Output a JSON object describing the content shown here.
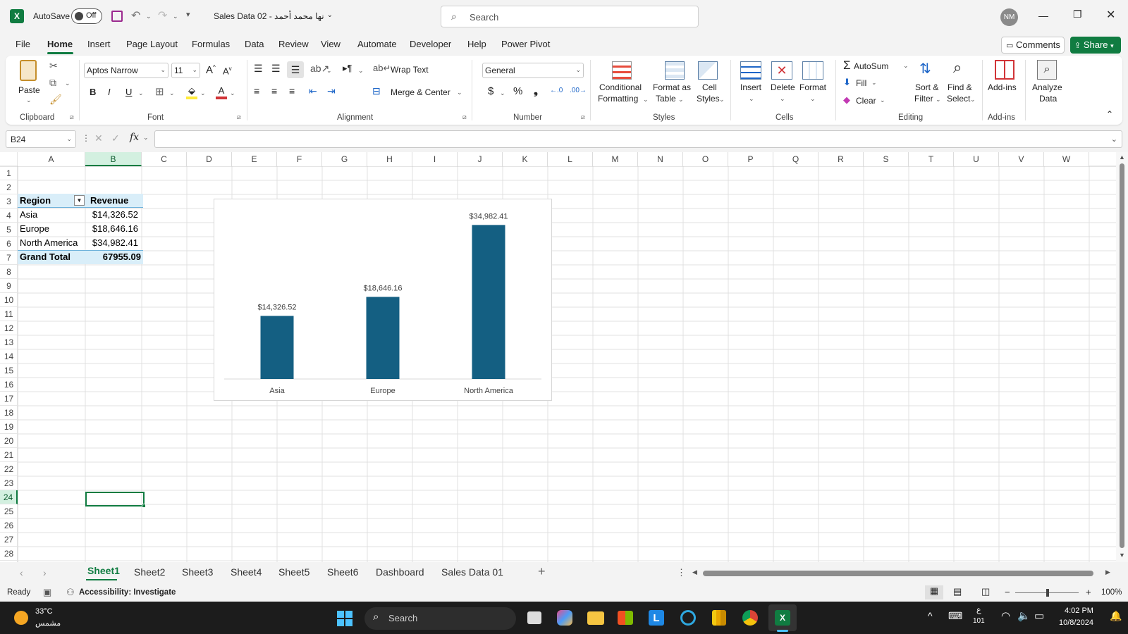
{
  "titlebar": {
    "autosave_label": "AutoSave",
    "autosave_state": "Off",
    "doc_title": "Sales Data 02 - نها محمد أحمد",
    "search_placeholder": "Search",
    "user_initials": "NM"
  },
  "menu": {
    "items": [
      "File",
      "Home",
      "Insert",
      "Page Layout",
      "Formulas",
      "Data",
      "Review",
      "View",
      "Automate",
      "Developer",
      "Help",
      "Power Pivot"
    ],
    "active": "Home",
    "comments_label": "Comments",
    "share_label": "Share"
  },
  "ribbon": {
    "paste": "Paste",
    "font_name": "Aptos Narrow",
    "font_size": "11",
    "wrap_text": "Wrap Text",
    "merge_center": "Merge & Center",
    "number_format": "General",
    "conditional_1": "Conditional",
    "conditional_2": "Formatting",
    "format_table_1": "Format as",
    "format_table_2": "Table",
    "cell_styles_1": "Cell",
    "cell_styles_2": "Styles",
    "insert": "Insert",
    "delete": "Delete",
    "format": "Format",
    "autosum": "AutoSum",
    "fill": "Fill",
    "clear": "Clear",
    "sort_1": "Sort &",
    "sort_2": "Filter",
    "find_1": "Find &",
    "find_2": "Select",
    "addins": "Add-ins",
    "analyze_1": "Analyze",
    "analyze_2": "Data",
    "groups": {
      "clipboard": "Clipboard",
      "font": "Font",
      "alignment": "Alignment",
      "number": "Number",
      "styles": "Styles",
      "cells": "Cells",
      "editing": "Editing",
      "addins": "Add-ins"
    }
  },
  "formula_bar": {
    "name_box": "B24",
    "fx": "fx",
    "content": ""
  },
  "grid": {
    "columns": [
      "A",
      "B",
      "C",
      "D",
      "E",
      "F",
      "G",
      "H",
      "I",
      "J",
      "K",
      "L",
      "M",
      "N",
      "O",
      "P",
      "Q",
      "R",
      "S",
      "T",
      "U",
      "V",
      "W"
    ],
    "rows": [
      "1",
      "2",
      "3",
      "4",
      "5",
      "6",
      "7",
      "8",
      "9",
      "10",
      "11",
      "12",
      "13",
      "14",
      "15",
      "16",
      "17",
      "18",
      "19",
      "20",
      "21",
      "22",
      "23",
      "24",
      "25",
      "26",
      "27",
      "28"
    ],
    "pivot": {
      "header_region": "Region",
      "header_revenue": "Revenue",
      "rows": [
        {
          "region": "Asia",
          "revenue": "$14,326.52"
        },
        {
          "region": "Europe",
          "revenue": "$18,646.16"
        },
        {
          "region": "North America",
          "revenue": "$34,982.41"
        }
      ],
      "total_label": "Grand Total",
      "total_value": "67955.09"
    }
  },
  "chart_data": {
    "type": "bar",
    "categories": [
      "Asia",
      "Europe",
      "North America"
    ],
    "values": [
      14326.52,
      18646.16,
      34982.41
    ],
    "data_labels": [
      "$14,326.52",
      "$18,646.16",
      "$34,982.41"
    ],
    "title": "",
    "xlabel": "",
    "ylabel": "",
    "ylim": [
      0,
      36000
    ],
    "grid": false,
    "legend": "none",
    "bar_color": "#145f82"
  },
  "sheets": {
    "tabs": [
      "Sheet1",
      "Sheet2",
      "Sheet3",
      "Sheet4",
      "Sheet5",
      "Sheet6",
      "Dashboard",
      "Sales Data 01"
    ],
    "active": "Sheet1"
  },
  "status": {
    "ready": "Ready",
    "accessibility": "Accessibility: Investigate",
    "zoom": "100%"
  },
  "taskbar": {
    "weather_temp": "33°C",
    "weather_desc": "مشمس",
    "search": "Search",
    "lang_top": "ع",
    "lang_bottom": "101",
    "time": "4:02 PM",
    "date": "10/8/2024"
  },
  "colors": {
    "excel_green": "#107c41",
    "accent_blue": "#145f82",
    "pivot_header": "#d9eef9"
  }
}
